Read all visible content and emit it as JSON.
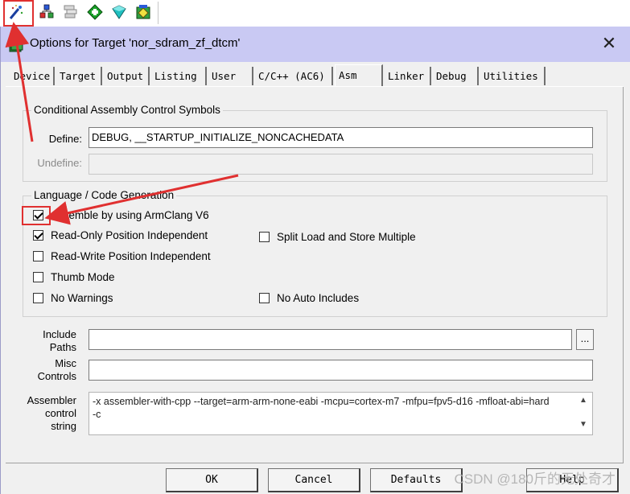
{
  "toolbar": {
    "buttons": [
      {
        "icon": "options-wand-icon",
        "label": "Options for Target"
      },
      {
        "icon": "file-extensions-icon"
      },
      {
        "icon": "manage-components-icon"
      },
      {
        "icon": "select-packs-icon"
      },
      {
        "icon": "manage-runtime-icon"
      },
      {
        "icon": "pack-installer-icon"
      }
    ]
  },
  "dialog": {
    "title": "Options for Target 'nor_sdram_zf_dtcm'",
    "close_glyph": "✕",
    "tabs": [
      {
        "label": "Device",
        "active": false
      },
      {
        "label": "Target",
        "active": false
      },
      {
        "label": "Output",
        "active": false
      },
      {
        "label": "Listing",
        "active": false
      },
      {
        "label": "User",
        "active": false
      },
      {
        "label": "C/C++ (AC6)",
        "active": false
      },
      {
        "label": "Asm",
        "active": true
      },
      {
        "label": "Linker",
        "active": false
      },
      {
        "label": "Debug",
        "active": false
      },
      {
        "label": "Utilities",
        "active": false
      }
    ],
    "conditional": {
      "title": "Conditional Assembly Control Symbols",
      "define_label": "Define:",
      "define_value": "DEBUG, __STARTUP_INITIALIZE_NONCACHEDATA",
      "undefine_label": "Undefine:",
      "undefine_value": ""
    },
    "language": {
      "title": "Language / Code Generation",
      "options": {
        "armclang": {
          "label": "Assemble by using ArmClang V6",
          "checked": true
        },
        "ropi": {
          "label": "Read-Only Position Independent",
          "checked": true
        },
        "rwpi": {
          "label": "Read-Write Position Independent",
          "checked": false
        },
        "thumb": {
          "label": "Thumb Mode",
          "checked": false
        },
        "nowarn": {
          "label": "No Warnings",
          "checked": false
        },
        "split": {
          "label": "Split Load and Store Multiple",
          "checked": false
        },
        "noauto": {
          "label": "No Auto Includes",
          "checked": false
        }
      }
    },
    "include_paths": {
      "label_1": "Include",
      "label_2": "Paths",
      "value": "",
      "browse": "..."
    },
    "misc_controls": {
      "label_1": "Misc",
      "label_2": "Controls",
      "value": ""
    },
    "control_string": {
      "label_1": "Assembler",
      "label_2": "control",
      "label_3": "string",
      "line_1": "-x assembler-with-cpp --target=arm-arm-none-eabi -mcpu=cortex-m7 -mfpu=fpv5-d16 -mfloat-abi=hard",
      "line_2": "-c",
      "scroll_up": "▲",
      "scroll_down": "▼"
    },
    "buttons": {
      "ok": "OK",
      "cancel": "Cancel",
      "defaults": "Defaults",
      "help": "Help"
    }
  },
  "watermark": "CSDN @180斤的无处奇才",
  "annotation_color": "#e03030"
}
